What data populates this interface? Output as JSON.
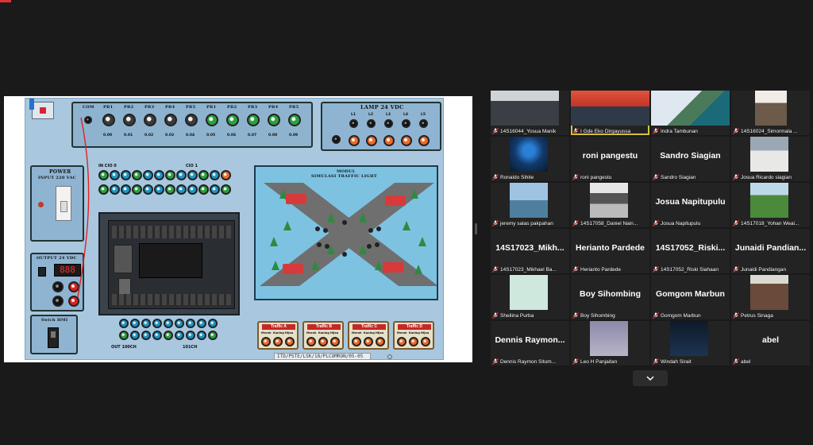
{
  "shared_screen": {
    "plate_code": "ITD/PSTE/LSK/18/PLCOMRON/05-05",
    "inputs_labels": [
      "COM",
      "PB1",
      "PB2",
      "PB3",
      "PB4",
      "PB5",
      "PB1",
      "PB2",
      "PB3",
      "PB4",
      "PB5"
    ],
    "input_addr": [
      "0.00",
      "0.01",
      "0.02",
      "0.03",
      "0.04",
      "0.05",
      "0.06",
      "0.07",
      "0.08",
      "0.09"
    ],
    "lamp_title": "LAMP 24 VDC",
    "lamp_labels": [
      "L1",
      "L2",
      "L3",
      "L4",
      "L5"
    ],
    "power_title": "POWER",
    "power_sub": "INPUT 220 VAC",
    "output_title": "OUTPUT 24 VDC",
    "switch_title": "Swich HMI",
    "cio0": "IN CIO 0",
    "cio1": "CIO 1",
    "out100": "OUT 100CH",
    "out101": "101CH",
    "model_title": "MODUL",
    "model_sub": "SIMULASI TRAFFIC LIGHT",
    "traffic": [
      "Traffic A",
      "Traffic B",
      "Traffic C",
      "Traffic D"
    ],
    "traffic_lamps": [
      "Merah",
      "Kuning",
      "Hijau"
    ],
    "display_value": "888"
  },
  "gallery": {
    "tiles": [
      {
        "name": "14S16044_Yosua Manik",
        "big": "",
        "video": "person-dark"
      },
      {
        "name": "I Gde Eko Dirgayussa",
        "big": "",
        "video": "person-red",
        "active": true
      },
      {
        "name": "Indra Tambunan",
        "big": "",
        "video": "building"
      },
      {
        "name": "14S16024_Simormala ...",
        "big": "",
        "video": "person-light"
      },
      {
        "name": "Ronaldo Sihite",
        "big": "",
        "video": "blue-abstract"
      },
      {
        "name": "roni pangestu",
        "big": "roni pangestu",
        "video": ""
      },
      {
        "name": "Sandro Siagian",
        "big": "Sandro Siagian",
        "video": ""
      },
      {
        "name": "Josua Ricardo siagian",
        "big": "",
        "video": "gate-photo"
      },
      {
        "name": "jeremy salas pakpahan",
        "big": "",
        "video": "lake"
      },
      {
        "name": "14S17058_Daniel Nain...",
        "big": "",
        "video": "bw-photo"
      },
      {
        "name": "Josua Napitupulu",
        "big": "Josua Napitupulu",
        "video": ""
      },
      {
        "name": "14S17018_Yohan Weal...",
        "big": "",
        "video": "green-field"
      },
      {
        "name": "14S17023_Mikhael Ba...",
        "big": "14S17023_Mikh...",
        "video": ""
      },
      {
        "name": "Herianto Pardede",
        "big": "Herianto Pardede",
        "video": ""
      },
      {
        "name": "14S17052_Riski Siahaan",
        "big": "14S17052_Riski...",
        "video": ""
      },
      {
        "name": "Junaidi Pandiangan",
        "big": "Junaidi Pandian...",
        "video": ""
      },
      {
        "name": "Sheilina Purba",
        "big": "",
        "video": "mint"
      },
      {
        "name": "Boy Sihombing",
        "big": "Boy Sihombing",
        "video": ""
      },
      {
        "name": "Gomgom Marbun",
        "big": "Gomgom Marbun",
        "video": ""
      },
      {
        "name": "Petrus Sinaga",
        "big": "",
        "video": "person-glasses"
      },
      {
        "name": "Dennis Raymon Situm...",
        "big": "Dennis Raymon...",
        "video": ""
      },
      {
        "name": "Leo H Panjaitan",
        "big": "",
        "video": "blur"
      },
      {
        "name": "Windah Sirait",
        "big": "",
        "video": "dark-blue"
      },
      {
        "name": "abel",
        "big": "abel",
        "video": ""
      }
    ]
  },
  "colors": {
    "active_speaker": "#d6c33a",
    "mic_muted": "#e53935",
    "tile_bg": "#232323",
    "app_bg": "#1a1a1a"
  },
  "icons": {
    "mic": "mic-muted-icon",
    "more": "chevron-down-icon"
  }
}
